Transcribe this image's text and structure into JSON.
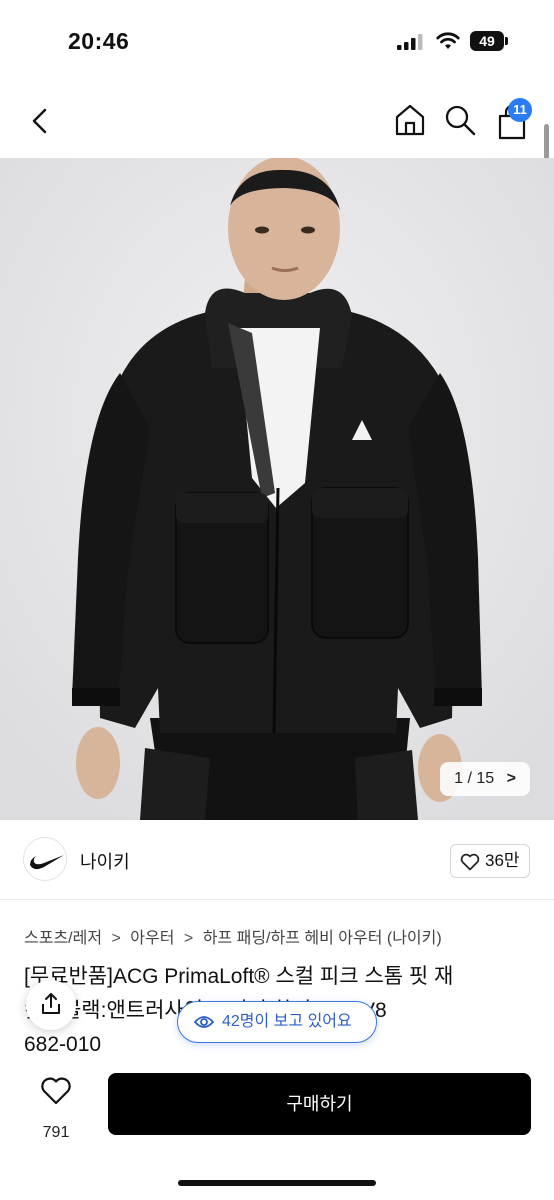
{
  "status_bar": {
    "time": "20:46",
    "battery": "49"
  },
  "nav": {
    "cart_count": "11"
  },
  "gallery": {
    "counter": "1 / 15",
    "counter_arrow": ">"
  },
  "seller": {
    "name": "나이키",
    "likes": "36만"
  },
  "breadcrumb": {
    "items": [
      "스포츠/레저",
      "아우터",
      "하프 패딩/하프 헤비 아우터 (나이키)"
    ],
    "separator": ">"
  },
  "product": {
    "title_line1": "[무료반품]ACG PrimaLoft® 스컬 피크 스톰 핏 재",
    "title_line2": "킷 - 블랙:앤트러사이트:서밋 화이트 / FV8",
    "title_line3": "682-010"
  },
  "viewers": {
    "text": "42명이 보고 있어요"
  },
  "bottom": {
    "wish_count": "791",
    "buy_label": "구매하기"
  },
  "colors": {
    "accent_blue": "#2a7cf2",
    "buy_button": "#000000",
    "viewers_blue": "#3b76e4"
  },
  "icons": [
    "signal-icon",
    "wifi-icon",
    "battery-icon",
    "back-icon",
    "home-icon",
    "search-icon",
    "cart-icon",
    "heart-icon",
    "share-icon",
    "eye-icon",
    "nike-swoosh-icon"
  ]
}
